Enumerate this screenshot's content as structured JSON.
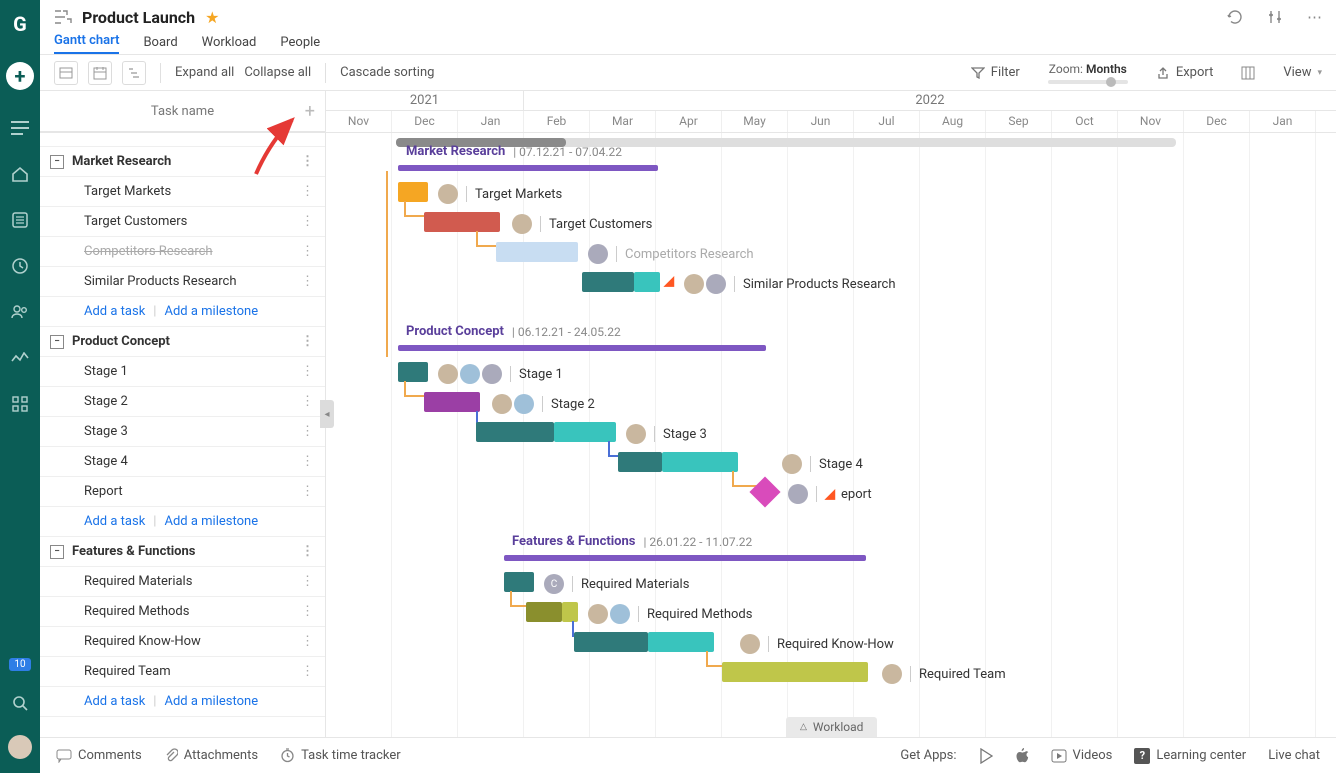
{
  "project": {
    "title": "Product Launch"
  },
  "tabs": [
    {
      "label": "Gantt chart",
      "active": true
    },
    {
      "label": "Board"
    },
    {
      "label": "Workload"
    },
    {
      "label": "People"
    }
  ],
  "toolbar": {
    "expand": "Expand all",
    "collapse": "Collapse all",
    "cascade": "Cascade sorting",
    "filter": "Filter",
    "zoom_label": "Zoom:",
    "zoom_value": "Months",
    "export": "Export",
    "view": "View"
  },
  "columns": {
    "task_name": "Task name"
  },
  "timeline": {
    "years": [
      "2021",
      "2022"
    ],
    "months": [
      "Nov",
      "Dec",
      "Jan",
      "Feb",
      "Mar",
      "Apr",
      "May",
      "Jun",
      "Jul",
      "Aug",
      "Sep",
      "Oct",
      "Nov",
      "Dec",
      "Jan"
    ]
  },
  "add_links": {
    "task": "Add a task",
    "milestone": "Add a milestone"
  },
  "groups": [
    {
      "name": "Market Research",
      "dates": "07.12.21 - 07.04.22",
      "tasks": [
        {
          "name": "Target Markets"
        },
        {
          "name": "Target Customers"
        },
        {
          "name": "Competitors Research",
          "strike": true
        },
        {
          "name": "Similar Products Research"
        }
      ]
    },
    {
      "name": "Product Concept",
      "dates": "06.12.21 - 24.05.22",
      "tasks": [
        {
          "name": "Stage 1"
        },
        {
          "name": "Stage 2"
        },
        {
          "name": "Stage 3"
        },
        {
          "name": "Stage 4"
        },
        {
          "name": "Report"
        }
      ]
    },
    {
      "name": "Features & Functions",
      "dates": "26.01.22 - 11.07.22",
      "tasks": [
        {
          "name": "Required Materials"
        },
        {
          "name": "Required Methods"
        },
        {
          "name": "Required Know-How"
        },
        {
          "name": "Required Team"
        }
      ]
    }
  ],
  "chart": {
    "workload_label": "Workload"
  },
  "footer": {
    "comments": "Comments",
    "attachments": "Attachments",
    "tracker": "Task time tracker",
    "get_apps": "Get Apps:",
    "videos": "Videos",
    "learning": "Learning center",
    "live_chat": "Live chat"
  },
  "sidebar": {
    "badge": "10"
  }
}
